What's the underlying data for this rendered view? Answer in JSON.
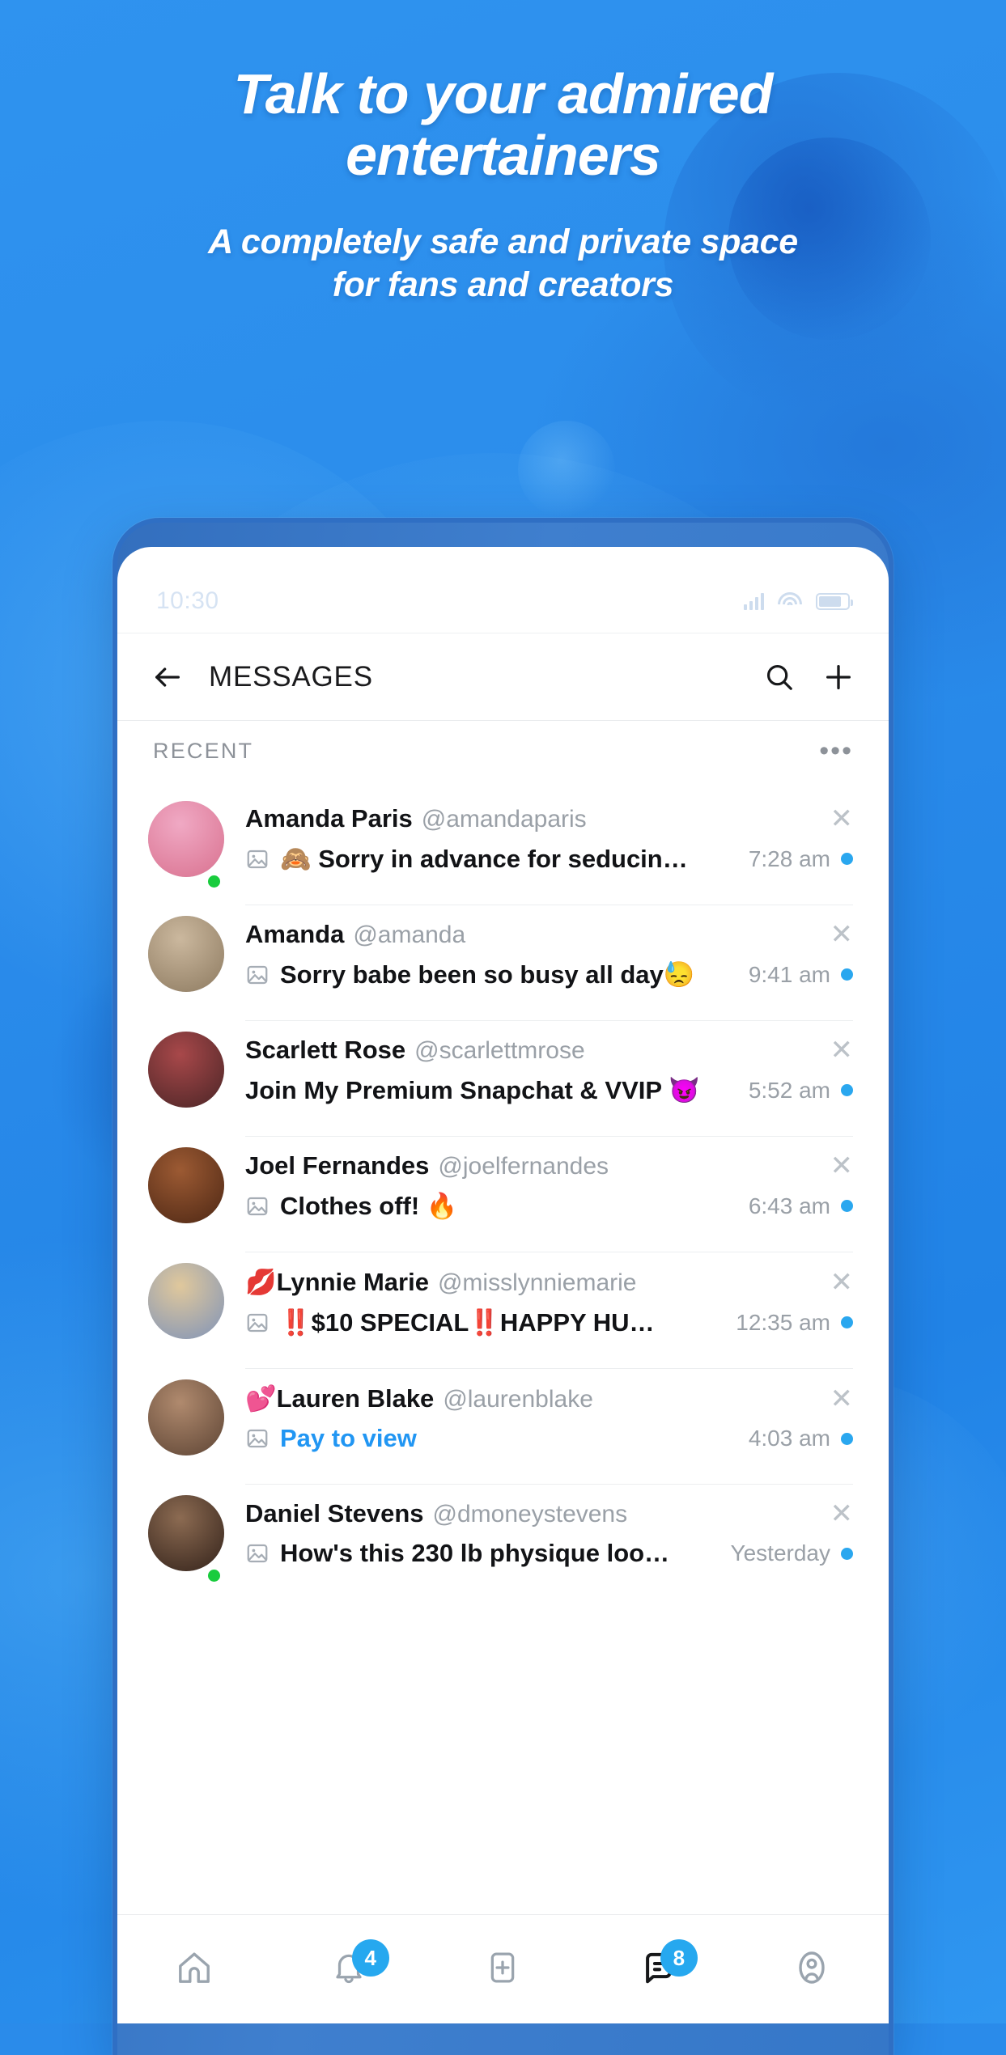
{
  "hero": {
    "title_line1": "Talk to your admired",
    "title_line2": "entertainers",
    "subtitle_line1": "A completely safe and private space",
    "subtitle_line2": "for fans and creators"
  },
  "statusbar": {
    "time": "10:30",
    "icons": [
      "signal-icon",
      "wifi-icon",
      "battery-icon"
    ]
  },
  "header": {
    "back_icon": "arrow-left-icon",
    "title": "MESSAGES",
    "search_icon": "search-icon",
    "new_message_icon": "plus-icon"
  },
  "recent": {
    "label": "RECENT",
    "more_label": "•••"
  },
  "conversations": [
    {
      "name": "Amanda Paris",
      "name_prefix": "",
      "handle": "@amandaparis",
      "preview": "🙈 Sorry in advance for seducin…",
      "has_image_icon": true,
      "is_pay_to_view": false,
      "time": "7:28 am",
      "unread": true,
      "online": true,
      "avatar_color_a": "#f0a9c4",
      "avatar_color_b": "#d9718f"
    },
    {
      "name": "Amanda",
      "name_prefix": "",
      "handle": "@amanda",
      "preview": "Sorry babe been so busy all day😓",
      "has_image_icon": true,
      "is_pay_to_view": false,
      "time": "9:41 am",
      "unread": true,
      "online": false,
      "avatar_color_a": "#cbb89e",
      "avatar_color_b": "#8d7a60"
    },
    {
      "name": "Scarlett Rose",
      "name_prefix": "",
      "handle": "@scarlettmrose",
      "preview": "Join My Premium Snapchat & VVIP 😈",
      "has_image_icon": false,
      "is_pay_to_view": false,
      "time": "5:52 am",
      "unread": true,
      "online": false,
      "avatar_color_a": "#a8484a",
      "avatar_color_b": "#4a2526"
    },
    {
      "name": "Joel Fernandes",
      "name_prefix": "",
      "handle": "@joelfernandes",
      "preview": "Clothes off! 🔥",
      "has_image_icon": true,
      "is_pay_to_view": false,
      "time": "6:43 am",
      "unread": true,
      "online": false,
      "avatar_color_a": "#9c5a33",
      "avatar_color_b": "#4d2714"
    },
    {
      "name": "Lynnie Marie",
      "name_prefix": "💋",
      "handle": "@misslynniemarie",
      "preview": "‼️$10 SPECIAL‼️HAPPY HU…",
      "has_image_icon": true,
      "is_pay_to_view": false,
      "time": "12:35 am",
      "unread": true,
      "online": false,
      "avatar_color_a": "#e0c89c",
      "avatar_color_b": "#7f93b8"
    },
    {
      "name": "Lauren Blake",
      "name_prefix": "💕",
      "handle": "@laurenblake",
      "preview": "Pay to view",
      "has_image_icon": true,
      "is_pay_to_view": true,
      "time": "4:03 am",
      "unread": true,
      "online": false,
      "avatar_color_a": "#b08a6e",
      "avatar_color_b": "#5d4434"
    },
    {
      "name": "Daniel Stevens",
      "name_prefix": "",
      "handle": "@dmoneystevens",
      "preview": "How's this 230 lb physique loo…",
      "has_image_icon": true,
      "is_pay_to_view": false,
      "time": "Yesterday",
      "unread": true,
      "online": true,
      "avatar_color_a": "#8c6b52",
      "avatar_color_b": "#33221a"
    }
  ],
  "bottom_nav": [
    {
      "icon": "home-icon",
      "badge": "",
      "active": false
    },
    {
      "icon": "bell-icon",
      "badge": "4",
      "active": false
    },
    {
      "icon": "plus-square-icon",
      "badge": "",
      "active": false
    },
    {
      "icon": "message-icon",
      "badge": "8",
      "active": true
    },
    {
      "icon": "profile-icon",
      "badge": "",
      "active": false
    }
  ],
  "colors": {
    "accent": "#2aa7ef",
    "brand_blue": "#2a8bea",
    "link": "#2196f3",
    "online": "#19cc3d",
    "muted_text": "#9aa0a7"
  }
}
